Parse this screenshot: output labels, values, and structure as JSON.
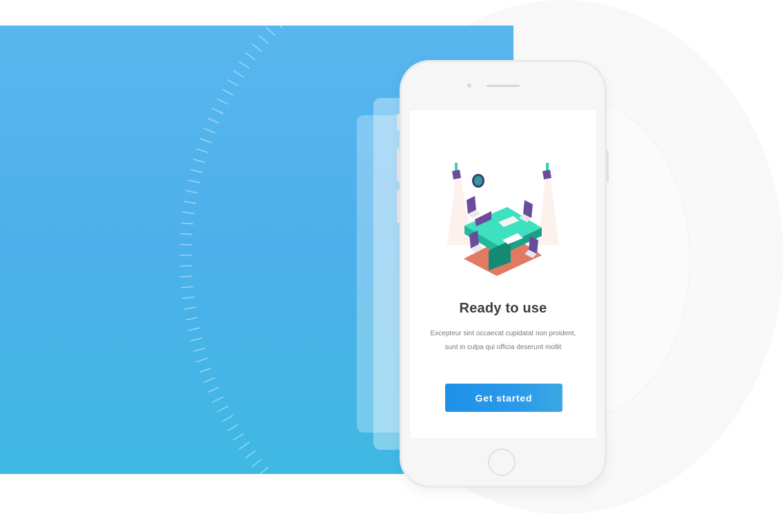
{
  "onboarding": {
    "title": "Ready to use",
    "description_line1": "Excepteur sint occaecat cupidatat non proident,",
    "description_line2": "sunt in culpa qui officia deserunt mollit",
    "cta_label": "Get started"
  },
  "colors": {
    "accent": "#1e90e8",
    "panel_top": "#59b6ef",
    "panel_bottom": "#3fb8e3",
    "title_text": "#3d3d3f",
    "body_text": "#7a7a7e"
  },
  "icons": {
    "illustration": "meeting-room-illustration"
  }
}
